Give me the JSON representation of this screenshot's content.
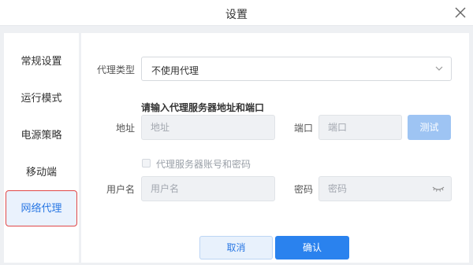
{
  "dialog": {
    "title": "设置"
  },
  "sidebar": {
    "items": [
      {
        "label": "常规设置"
      },
      {
        "label": "运行模式"
      },
      {
        "label": "电源策略"
      },
      {
        "label": "移动端"
      },
      {
        "label": "网络代理",
        "active": true
      }
    ]
  },
  "proxy": {
    "type_label": "代理类型",
    "type_value": "不使用代理",
    "section_title": "请输入代理服务器地址和端口",
    "address_label": "地址",
    "address_placeholder": "地址",
    "port_label": "端口",
    "port_placeholder": "端口",
    "test_label": "测试",
    "auth_checkbox_label": "代理服务器账号和密码",
    "auth_checked": false,
    "username_label": "用户名",
    "username_placeholder": "用户名",
    "password_label": "密码",
    "password_placeholder": "密码"
  },
  "footer": {
    "cancel_label": "取消",
    "ok_label": "确认"
  },
  "colors": {
    "accent": "#2a82ee",
    "accent_light": "#9ec4f3",
    "highlight_border": "#e04848",
    "panel_bg": "#eef0f3"
  },
  "icons": {
    "close": "close-icon",
    "dropdown": "chevron-down-icon",
    "password_toggle": "eye-closed-icon"
  }
}
